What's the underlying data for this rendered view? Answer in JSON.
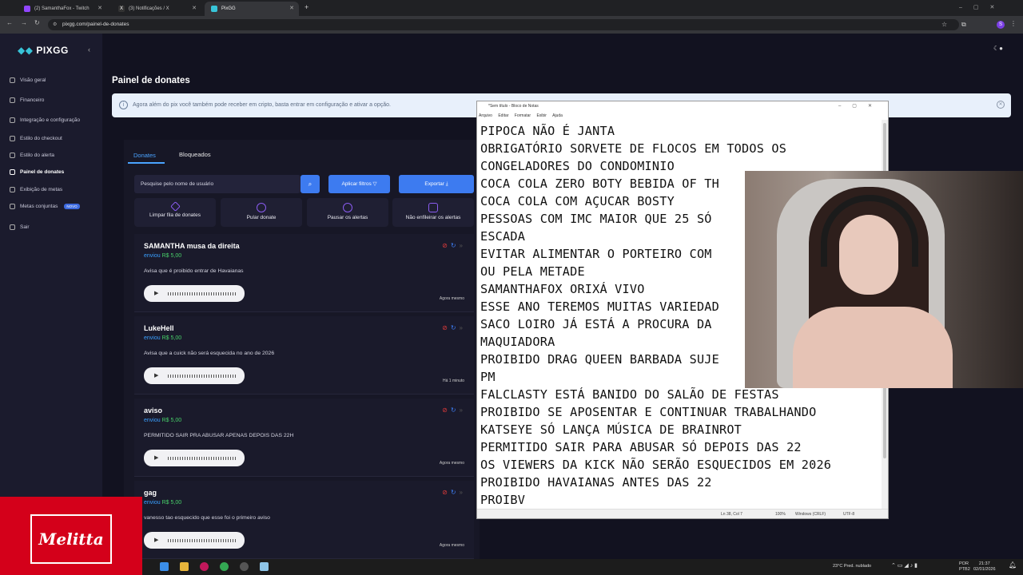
{
  "browser": {
    "tabs": [
      {
        "title": "(2) SamanthaFox - Twitch",
        "color": "#9146ff"
      },
      {
        "title": "(3) Notificações / X",
        "color": "#cccccc"
      },
      {
        "title": "PixGG",
        "color": "#38c4d8"
      }
    ],
    "url": "pixgg.com/painel-de-donates",
    "new_tab": "+",
    "avatar": "S"
  },
  "sidebar": {
    "logo": "PIXGG",
    "items": [
      {
        "label": "Visão geral"
      },
      {
        "label": "Financeiro"
      },
      {
        "label": "Integração e configuração"
      },
      {
        "label": "Estilo do checkout"
      },
      {
        "label": "Estilo do alerta"
      },
      {
        "label": "Painel de donates"
      },
      {
        "label": "Exibição de metas"
      },
      {
        "label": "Metas conjuntas",
        "badge": "NOVO"
      },
      {
        "label": "Sair"
      }
    ]
  },
  "main": {
    "title": "Painel de donates",
    "info": "Agora além do pix você também pode receber em cripto, basta entrar em configuração e ativar a opção.",
    "tabs": [
      "Donates",
      "Bloqueados"
    ],
    "search_placeholder": "Pesquise pelo nome de usuário",
    "filter_label": "Aplicar filtros",
    "export_label": "Exportar",
    "actions": [
      "Limpar fila de donates",
      "Pular donate",
      "Pausar os alertas",
      "Não enfileirar os alertas"
    ],
    "donations": [
      {
        "name": "SAMANTHA musa da direita",
        "prefix": "enviou",
        "amount": "R$ 5,00",
        "message": "Avisa que é proibido entrar de Havaianas",
        "time": "Agora mesmo"
      },
      {
        "name": "LukeHell",
        "prefix": "enviou",
        "amount": "R$ 5,00",
        "message": "Avisa que a cuick não será esquecida no ano de 2026",
        "time": "Há 1 minuto"
      },
      {
        "name": "aviso",
        "prefix": "enviou",
        "amount": "R$ 5,00",
        "message": "PERMITIDO SAIR PRA ABUSAR APENAS DEPOIS DAS 22H",
        "time": "Agora mesmo"
      },
      {
        "name": "gag",
        "prefix": "enviou",
        "amount": "R$ 5,00",
        "message": "vanesso tao esquecido que esse foi o primeiro aviso",
        "time": "Agora mesmo"
      }
    ]
  },
  "notepad": {
    "title": "*Sem título - Bloco de Notas",
    "menu": [
      "Arquivo",
      "Editar",
      "Formatar",
      "Exibir",
      "Ajuda"
    ],
    "lines": [
      "PIPOCA NÃO É JANTA",
      "OBRIGATÓRIO SORVETE DE FLOCOS EM TODOS OS",
      "CONGELADORES DO CONDOMINIO",
      "COCA COLA ZERO BOTY BEBIDA OF TH",
      "COCA COLA COM AÇUCAR BOSTY",
      "PESSOAS COM IMC MAIOR QUE 25 SÓ",
      "ESCADA",
      "EVITAR ALIMENTAR O PORTEIRO COM",
      "OU PELA METADE",
      "SAMANTHAFOX ORIXÁ VIVO",
      "ESSE ANO TEREMOS MUITAS VARIEDAD",
      "SACO LOIRO JÁ ESTÁ A PROCURA DA",
      "MAQUIADORA",
      "PROIBIDO DRAG QUEEN BARBADA SUJE",
      "PM",
      "FALCLASTY ESTÁ BANIDO DO SALÃO DE FESTAS",
      "PROIBIDO SE APOSENTAR E CONTINUAR TRABALHANDO",
      "KATSEYE SÓ LANÇA MÚSICA DE BRAINROT",
      "PERMITIDO SAIR PARA ABUSAR SÓ DEPOIS DAS 22",
      "OS VIEWERS DA KICK NÃO SERÃO ESQUECIDOS EM 2026",
      "PROIBIDO HAVAIANAS ANTES DAS 22",
      "PROIBV"
    ],
    "status": {
      "pos": "Ln 38, Col 7",
      "zoom": "100%",
      "eol": "Windows (CRLF)",
      "enc": "UTF-8"
    }
  },
  "overlay": {
    "brand": "Melitta"
  },
  "taskbar": {
    "weather": "23°C  Pred. nublado",
    "lang": "POR",
    "lang2": "PTB2",
    "time": "21:37",
    "date": "02/01/2026"
  }
}
